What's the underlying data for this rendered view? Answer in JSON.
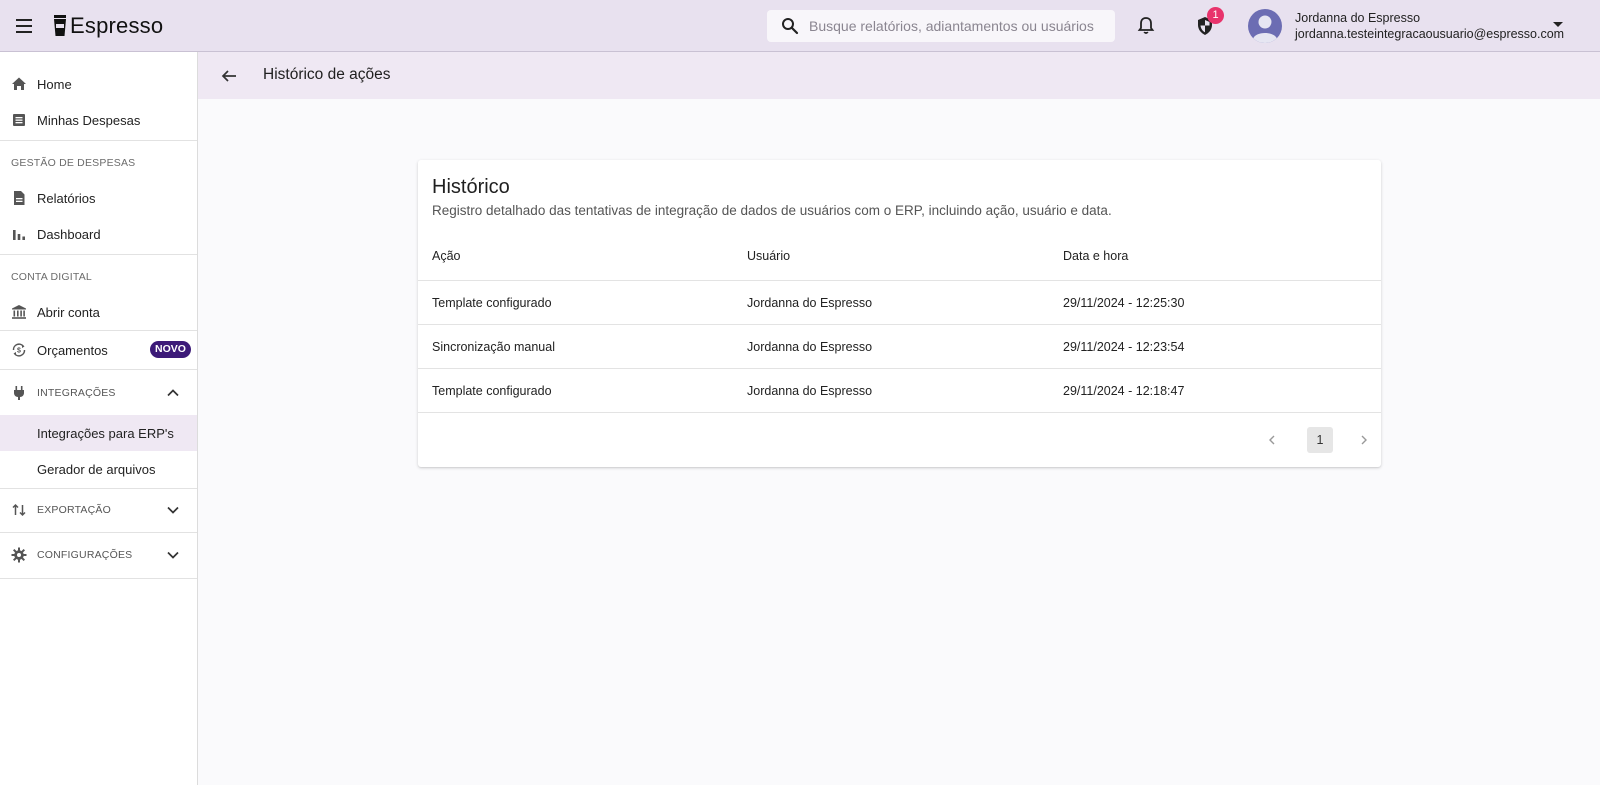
{
  "app": {
    "title": "Espresso"
  },
  "header": {
    "search_placeholder": "Busque relatórios, adiantamentos ou usuários",
    "notification_count": "1",
    "user_name": "Jordanna do Espresso",
    "user_email": "jordanna.testeintegracaousuario@espresso.com"
  },
  "sidebar": {
    "home": "Home",
    "minhas_despesas": "Minhas Despesas",
    "section_gestao": "GESTÃO DE DESPESAS",
    "relatorios": "Relatórios",
    "dashboard": "Dashboard",
    "section_conta": "CONTA DIGITAL",
    "abrir_conta": "Abrir conta",
    "orcamentos": "Orçamentos",
    "novo_badge": "NOVO",
    "integracoes": "INTEGRAÇÕES",
    "integracoes_erp": "Integrações para ERP's",
    "gerador": "Gerador de arquivos",
    "exportacao": "EXPORTAÇÃO",
    "configuracoes": "CONFIGURAÇÕES"
  },
  "page": {
    "title": "Histórico de ações"
  },
  "card": {
    "title": "Histórico",
    "subtitle": "Registro detalhado das tentativas de integração de dados de usuários com o ERP, incluindo ação, usuário e data.",
    "columns": [
      "Ação",
      "Usuário",
      "Data e hora"
    ],
    "rows": [
      {
        "acao": "Template configurado",
        "usuario": "Jordanna do Espresso",
        "data": "29/11/2024 - 12:25:30"
      },
      {
        "acao": "Sincronização manual",
        "usuario": "Jordanna do Espresso",
        "data": "29/11/2024 - 12:23:54"
      },
      {
        "acao": "Template configurado",
        "usuario": "Jordanna do Espresso",
        "data": "29/11/2024 - 12:18:47"
      }
    ],
    "current_page": "1"
  }
}
